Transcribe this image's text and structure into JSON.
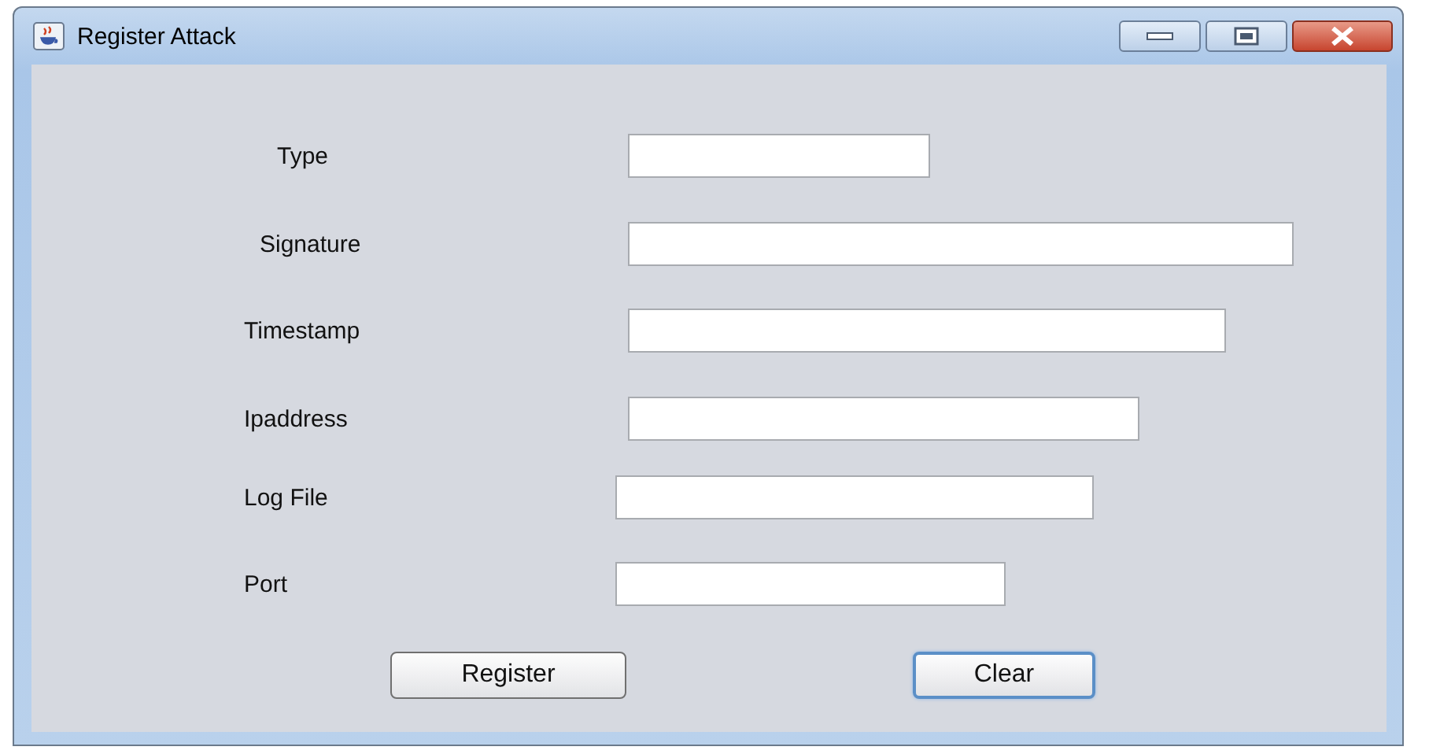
{
  "window": {
    "title": "Register Attack"
  },
  "fields": [
    {
      "label": "Type"
    },
    {
      "label": "Signature"
    },
    {
      "label": "Timestamp"
    },
    {
      "label": "Ipaddress"
    },
    {
      "label": "Log File"
    },
    {
      "label": "Port"
    }
  ],
  "buttons": [
    {
      "label": "Register",
      "focused": false
    },
    {
      "label": "Clear",
      "focused": true
    }
  ]
}
